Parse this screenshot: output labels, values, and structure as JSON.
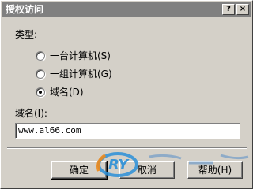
{
  "window": {
    "title": "授权访问",
    "help_glyph": "?",
    "close_glyph": "×"
  },
  "type_section": {
    "label": "类型:",
    "options": [
      {
        "label": "一台计算机(S)",
        "checked": false
      },
      {
        "label": "一组计算机(G)",
        "checked": false
      },
      {
        "label": "域名(D)",
        "checked": true
      }
    ]
  },
  "domain_field": {
    "label": "域名(I):",
    "value": "www.al66.com"
  },
  "buttons": {
    "ok": "确定",
    "cancel": "取消",
    "help": "帮助(H)"
  },
  "watermark": {
    "text": "RY",
    "accent_color": "#2a8fd8"
  }
}
